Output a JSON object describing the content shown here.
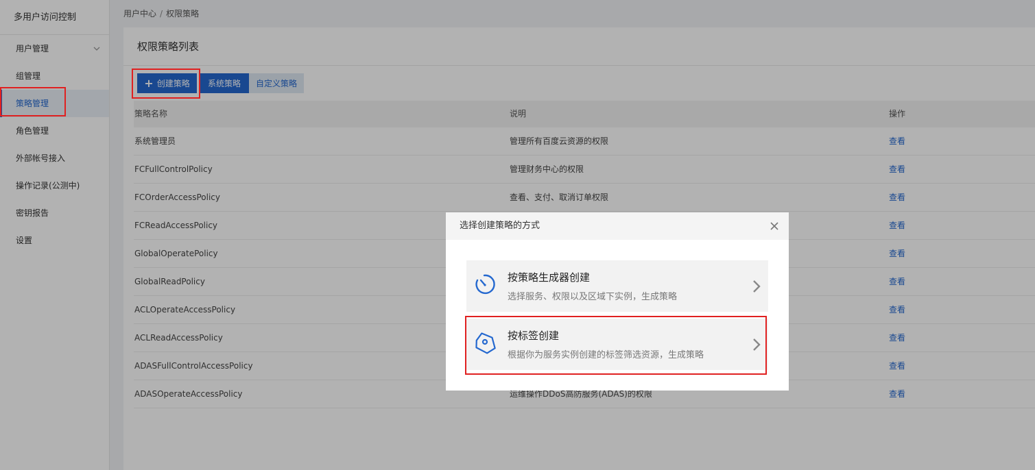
{
  "sidebar": {
    "title": "多用户访问控制",
    "items": [
      {
        "label": "用户管理"
      },
      {
        "label": "组管理"
      },
      {
        "label": "策略管理"
      },
      {
        "label": "角色管理"
      },
      {
        "label": "外部帐号接入"
      },
      {
        "label": "操作记录(公测中)"
      },
      {
        "label": "密钥报告"
      },
      {
        "label": "设置"
      }
    ]
  },
  "breadcrumb": {
    "root": "用户中心",
    "separator": "/",
    "current": "权限策略"
  },
  "panel": {
    "title": "权限策略列表",
    "create_label": "创建策略",
    "system_label": "系统策略",
    "custom_label": "自定义策略"
  },
  "table": {
    "headers": [
      "策略名称",
      "说明",
      "操作"
    ],
    "rows": [
      {
        "name": "系统管理员",
        "desc": "管理所有百度云资源的权限",
        "action": "查看"
      },
      {
        "name": "FCFullControlPolicy",
        "desc": "管理财务中心的权限",
        "action": "查看"
      },
      {
        "name": "FCOrderAccessPolicy",
        "desc": "查看、支付、取消订单权限",
        "action": "查看"
      },
      {
        "name": "FCReadAccessPolicy",
        "desc": "",
        "action": "查看"
      },
      {
        "name": "GlobalOperatePolicy",
        "desc": "",
        "action": "查看"
      },
      {
        "name": "GlobalReadPolicy",
        "desc": "",
        "action": "查看"
      },
      {
        "name": "ACLOperateAccessPolicy",
        "desc": "",
        "action": "查看"
      },
      {
        "name": "ACLReadAccessPolicy",
        "desc": "",
        "action": "查看"
      },
      {
        "name": "ADASFullControlAccessPolicy",
        "desc": "",
        "action": "查看"
      },
      {
        "name": "ADASOperateAccessPolicy",
        "desc": "运维操作DDoS高防服务(ADAS)的权限",
        "action": "查看"
      }
    ]
  },
  "modal": {
    "title": "选择创建策略的方式",
    "options": [
      {
        "title": "按策略生成器创建",
        "desc": "选择服务、权限以及区域下实例，生成策略",
        "icon": "timer-icon"
      },
      {
        "title": "按标签创建",
        "desc": "根据你为服务实例创建的标签筛选资源，生成策略",
        "icon": "tag-icon"
      }
    ]
  },
  "colors": {
    "accent": "#2468cf",
    "highlight": "#e02020",
    "overlay": "rgba(0,0,0,0.3)"
  }
}
